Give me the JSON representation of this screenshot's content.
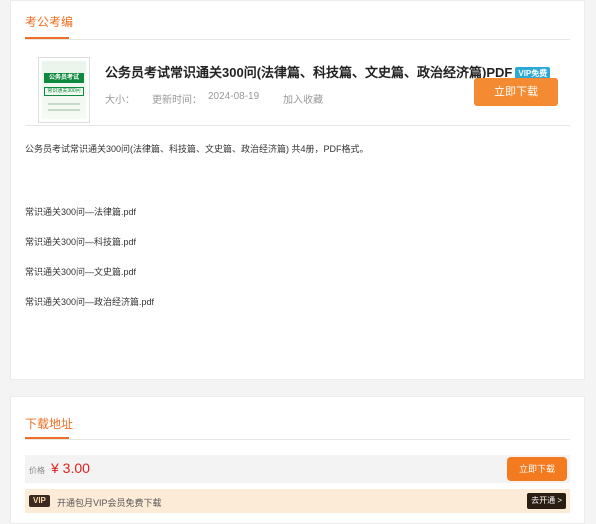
{
  "resource_section": {
    "title": "考公考编"
  },
  "file": {
    "title": "公务员考试常识通关300问(法律篇、科技篇、文史篇、政治经济篇)PDF",
    "vip_badge": "VIP免费",
    "thumb_banner": "公务员考试",
    "thumb_sub": "常识通关300问",
    "size_label": "大小：",
    "update_label": "更新时间：",
    "update_date": "2024-08-19",
    "favorite_label": "加入收藏",
    "download_label": "立即下载"
  },
  "description": {
    "summary": "公务员考试常识通关300问(法律篇、科技篇、文史篇、政治经济篇) 共4册，PDF格式。",
    "files": [
      "常识通关300问—法律篇.pdf",
      "常识通关300问—科技篇.pdf",
      "常识通关300问—文史篇.pdf",
      "常识通关300问—政治经济篇.pdf"
    ]
  },
  "download_section": {
    "title": "下载地址",
    "price_label": "价格",
    "price_value": "¥ 3.00",
    "download_label": "立即下载",
    "vip_tag": "VIP",
    "vip_text": "开通包月VIP会员免费下载",
    "vip_open_label": "去开通 >"
  },
  "colors": {
    "accent": "#ee6f24",
    "price": "#e0201b",
    "vip_badge": "#2ea8d6"
  }
}
